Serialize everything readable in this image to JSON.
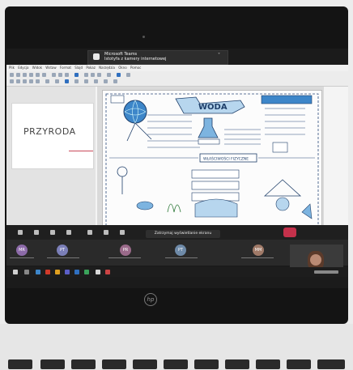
{
  "teams_toast": {
    "app": "Microsoft Teams",
    "message": "Istotyfa z kamery internetowej"
  },
  "impress": {
    "menu": [
      "Plik",
      "Edycja",
      "Widok",
      "Wstaw",
      "Format",
      "Slajd",
      "Pokaz",
      "Narzędzia",
      "Okno",
      "Pomoc"
    ],
    "slide_title": "PRZYRODA",
    "sketch_title": "WODA",
    "sketch_box_label": "WŁAŚCIWOŚCI FIZYCZNE"
  },
  "call": {
    "share_banner": "Zatrzymaj wyświetlanie ekranu"
  },
  "participants": [
    {
      "initials": "MR",
      "color": "#8c6aa8"
    },
    {
      "initials": "PT",
      "color": "#7b7fb8"
    },
    {
      "initials": "PR",
      "color": "#9a6a8a"
    },
    {
      "initials": "PT",
      "color": "#6e8aa8"
    },
    {
      "initials": "MM",
      "color": "#a07a68"
    }
  ],
  "logo": "hp"
}
